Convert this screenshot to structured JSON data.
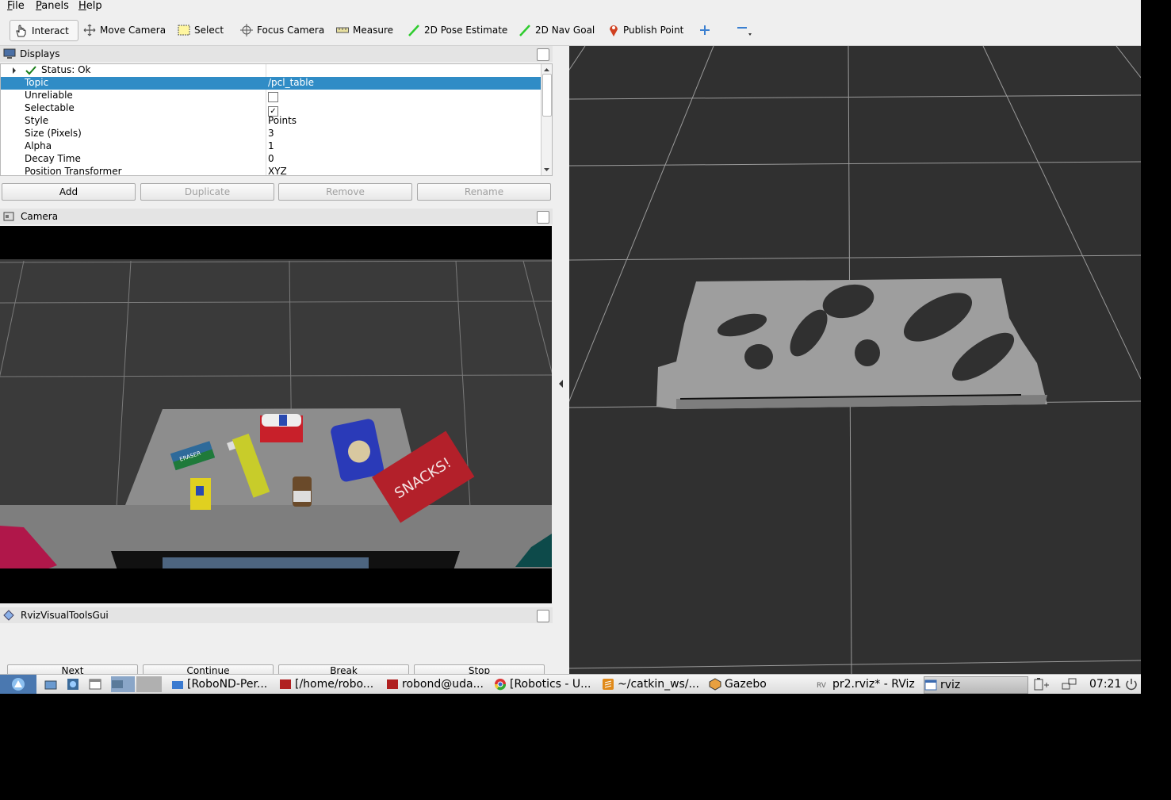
{
  "menu": {
    "file": "File",
    "panels": "Panels",
    "help": "Help"
  },
  "toolbar": {
    "interact": "Interact",
    "move_camera": "Move Camera",
    "select": "Select",
    "focus_camera": "Focus Camera",
    "measure": "Measure",
    "pose_estimate": "2D Pose Estimate",
    "nav_goal": "2D Nav Goal",
    "publish_point": "Publish Point"
  },
  "displays": {
    "title": "Displays",
    "status": "Status: Ok",
    "rows": [
      {
        "key": "Topic",
        "value": "/pcl_table"
      },
      {
        "key": "Unreliable",
        "value": ""
      },
      {
        "key": "Selectable",
        "value": "✓"
      },
      {
        "key": "Style",
        "value": "Points"
      },
      {
        "key": "Size (Pixels)",
        "value": "3"
      },
      {
        "key": "Alpha",
        "value": "1"
      },
      {
        "key": "Decay Time",
        "value": "0"
      },
      {
        "key": "Position Transformer",
        "value": "XYZ"
      }
    ],
    "buttons": {
      "add": "Add",
      "duplicate": "Duplicate",
      "remove": "Remove",
      "rename": "Rename"
    }
  },
  "camera": {
    "title": "Camera",
    "labels": {
      "eraser": "ERASER",
      "snacks": "SNACKS!"
    }
  },
  "rviz_gui": {
    "title": "RvizVisualToolsGui",
    "buttons": {
      "next": "Next",
      "continue": "Continue",
      "break": "Break",
      "stop": "Stop"
    }
  },
  "taskbar": {
    "tasks": [
      "[RoboND-Per...",
      "[/home/robo...",
      "robond@uda...",
      "[Robotics - U...",
      "~/catkin_ws/...",
      "Gazebo",
      "pr2.rviz* - RViz",
      "rviz"
    ],
    "clock": "07:21"
  },
  "colors": {
    "selection": "#308cc6",
    "panel_bg": "#efefef",
    "view_bg": "#303030",
    "grid": "#a0a0a0",
    "table": "#8c8c8c",
    "snacks_red": "#b3202a"
  }
}
